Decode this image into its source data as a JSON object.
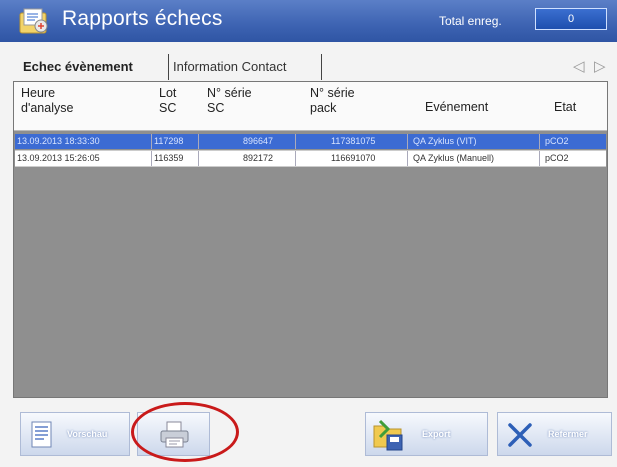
{
  "header": {
    "title": "Rapports échecs",
    "total_label": "Total enreg.",
    "total_value": "0"
  },
  "tabs": [
    {
      "label": "Echec évènement",
      "active": true
    },
    {
      "label": "Information Contact",
      "active": false
    }
  ],
  "table": {
    "columns": [
      [
        "Heure",
        "d'analyse"
      ],
      [
        "Lot",
        "SC"
      ],
      [
        "N° série",
        "SC"
      ],
      [
        "N° série",
        "pack"
      ],
      [
        "Evénement"
      ],
      [
        "Etat"
      ]
    ],
    "rows": [
      {
        "selected": true,
        "cells": [
          "13.09.2013 18:33:30",
          "117298",
          "896647",
          "117381075",
          "QA Zyklus (VIT)",
          "pCO2"
        ]
      },
      {
        "selected": false,
        "cells": [
          "13.09.2013 15:26:05",
          "116359",
          "892172",
          "116691070",
          "QA Zyklus (Manuell)",
          "pCO2"
        ]
      }
    ]
  },
  "buttons": {
    "preview": "Vorschau",
    "export": "Export",
    "close": "Refermer"
  },
  "colors": {
    "header": "#3d63b2",
    "selected_row": "#3c6bd3",
    "highlight_circle": "#c91a1a"
  }
}
